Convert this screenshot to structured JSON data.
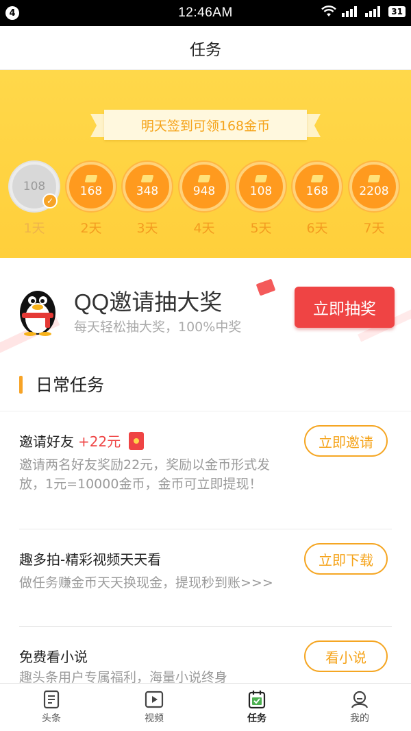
{
  "status_bar": {
    "notification_count": "4",
    "time": "12:46AM",
    "network_label": "ııl",
    "battery": "31"
  },
  "header": {
    "title": "任务"
  },
  "signin": {
    "ribbon_text": "明天签到可领168金币",
    "days": [
      {
        "coins": "108",
        "label": "1天",
        "done": true
      },
      {
        "coins": "168",
        "label": "2天",
        "done": false
      },
      {
        "coins": "348",
        "label": "3天",
        "done": false
      },
      {
        "coins": "948",
        "label": "4天",
        "done": false
      },
      {
        "coins": "108",
        "label": "5天",
        "done": false
      },
      {
        "coins": "168",
        "label": "6天",
        "done": false
      },
      {
        "coins": "2208",
        "label": "7天",
        "done": false
      }
    ]
  },
  "promo": {
    "title": "QQ邀请抽大奖",
    "subtitle": "每天轻松抽大奖，100%中奖",
    "button_label": "立即抽奖"
  },
  "daily_tasks": {
    "section_title": "日常任务",
    "items": [
      {
        "title": "邀请好友",
        "reward": "+22元",
        "description": "邀请两名好友奖励22元，奖励以金币形式发放，1元=10000金币，金币可立即提现！",
        "button_label": "立即邀请"
      },
      {
        "title": "趣多拍-精彩视频天天看",
        "reward": "",
        "description": "做任务赚金币天天换现金，提现秒到账>>>",
        "button_label": "立即下载"
      },
      {
        "title": "免费看小说",
        "reward": "",
        "description": "趣头条用户专属福利，海量小说终身",
        "button_label": "看小说"
      }
    ]
  },
  "tab_bar": {
    "items": [
      {
        "label": "头条",
        "icon": "news-icon"
      },
      {
        "label": "视频",
        "icon": "video-icon"
      },
      {
        "label": "任务",
        "icon": "task-icon",
        "active": true
      },
      {
        "label": "我的",
        "icon": "profile-icon"
      }
    ]
  },
  "colors": {
    "accent_orange": "#f5a623",
    "banner_yellow": "#ffd84a",
    "coin_orange": "#ff9a1e",
    "red": "#ef4444"
  }
}
